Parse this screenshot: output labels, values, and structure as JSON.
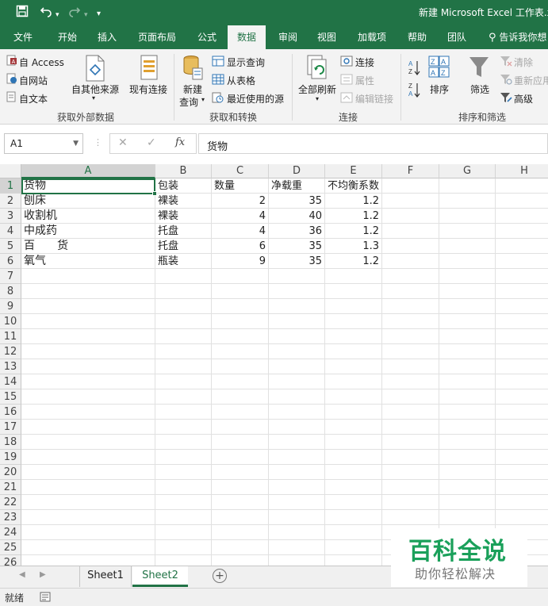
{
  "window": {
    "title": "新建 Microsoft Excel 工作表.x"
  },
  "qat": {
    "save_icon": "save-icon",
    "undo_icon": "undo-icon",
    "redo_icon": "redo-icon",
    "customize_icon": "customize-icon"
  },
  "tabs": [
    "文件",
    "开始",
    "插入",
    "页面布局",
    "公式",
    "数据",
    "审阅",
    "视图",
    "加载项",
    "帮助",
    "团队"
  ],
  "active_tab": "数据",
  "tell_me": "告诉我你想",
  "ribbon": {
    "get_external": {
      "from_access": "自 Access",
      "from_web": "自网站",
      "from_text": "自文本",
      "from_other": "自其他来源",
      "existing": "现有连接",
      "group": "获取外部数据"
    },
    "get_transform": {
      "new_query_1": "新建",
      "new_query_2": "查询",
      "show_queries": "显示查询",
      "from_table": "从表格",
      "recent_sources": "最近使用的源",
      "group": "获取和转换"
    },
    "connections": {
      "refresh_all": "全部刷新",
      "connections": "连接",
      "properties": "属性",
      "edit_links": "编辑链接",
      "group": "连接"
    },
    "sort_filter": {
      "sort": "排序",
      "filter": "筛选",
      "clear": "清除",
      "reapply": "重新应用",
      "advanced": "高级",
      "group": "排序和筛选"
    }
  },
  "formula_bar": {
    "name_box": "A1",
    "cancel": "✕",
    "enter": "✓",
    "fx": "fx",
    "value": "货物"
  },
  "columns": [
    "A",
    "B",
    "C",
    "D",
    "E",
    "F",
    "G",
    "H"
  ],
  "rows": [
    "1",
    "2",
    "3",
    "4",
    "5",
    "6",
    "7",
    "8",
    "9",
    "10",
    "11",
    "12",
    "13",
    "14",
    "15",
    "16",
    "17",
    "18",
    "19",
    "20",
    "21",
    "22",
    "23",
    "24",
    "25",
    "26"
  ],
  "cells": {
    "headers": [
      "货物",
      "包装",
      "数量",
      "净载重",
      "不均衡系数"
    ],
    "data": [
      [
        "刨床",
        "裸装",
        "2",
        "35",
        "1.2"
      ],
      [
        "收割机",
        "裸装",
        "4",
        "40",
        "1.2"
      ],
      [
        "中成药",
        "托盘",
        "4",
        "36",
        "1.2"
      ],
      [
        "百　　货",
        "托盘",
        "6",
        "35",
        "1.3"
      ],
      [
        "氧气",
        "瓶装",
        "9",
        "35",
        "1.2"
      ]
    ]
  },
  "sheets": [
    "Sheet1",
    "Sheet2"
  ],
  "active_sheet": "Sheet2",
  "status": {
    "ready": "就绪"
  },
  "watermark": {
    "line1": "百科全说",
    "line2": "助你轻松解决"
  },
  "colors": {
    "excel_green": "#217346",
    "watermark_green": "#1aa05a"
  }
}
